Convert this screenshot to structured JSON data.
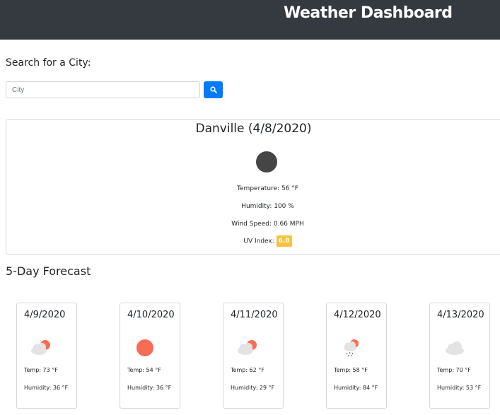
{
  "header": {
    "title": "Weather Dashboard"
  },
  "search": {
    "label": "Search for a City:",
    "placeholder": "City",
    "button_icon": "search-icon"
  },
  "current": {
    "title": "Danville (4/8/2020)",
    "icon": "dark-circle-icon",
    "temperature": "Temperature: 56 °F",
    "humidity": "Humidity: 100 %",
    "wind": "Wind Speed: 0.66 MPH",
    "uv_label": "UV Index:",
    "uv_value": "6.8"
  },
  "forecast": {
    "title": "5-Day Forecast",
    "days": [
      {
        "date": "4/9/2020",
        "icon": "partly-cloudy-icon",
        "temp": "Temp: 73 °F",
        "humidity": "Humidity: 36 °F"
      },
      {
        "date": "4/10/2020",
        "icon": "sun-icon",
        "temp": "Temp: 54 °F",
        "humidity": "Humidity: 36 °F"
      },
      {
        "date": "4/11/2020",
        "icon": "partly-cloudy-icon",
        "temp": "Temp: 62 °F",
        "humidity": "Humidity: 29 °F"
      },
      {
        "date": "4/12/2020",
        "icon": "rain-icon",
        "temp": "Temp: 58 °F",
        "humidity": "Humidity: 84 °F"
      },
      {
        "date": "4/13/2020",
        "icon": "cloud-icon",
        "temp": "Temp: 70 °F",
        "humidity": "Humidity: 53 °F"
      }
    ]
  },
  "colors": {
    "header_bg": "#343a40",
    "button": "#007bff",
    "uv_badge": "#f9c23c",
    "sun": "#f86c56",
    "cloud": "#e3e3e3"
  }
}
